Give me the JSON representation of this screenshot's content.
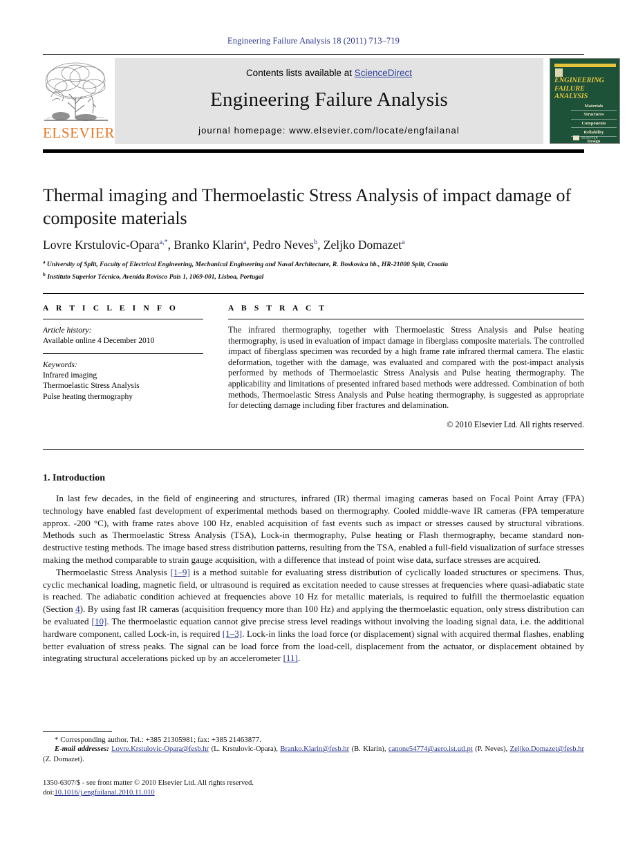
{
  "running_head": "Engineering Failure Analysis 18 (2011) 713–719",
  "masthead": {
    "contents_prefix": "Contents lists available at ",
    "sciencedirect": "ScienceDirect",
    "journal_title": "Engineering Failure Analysis",
    "homepage_label": "journal homepage: www.elsevier.com/locate/engfailanal",
    "publisher": "ELSEVIER",
    "cover": {
      "line1": "ENGINEERING",
      "line2": "FAILURE",
      "line3": "ANALYSIS",
      "topics": [
        "Materials",
        "Structures",
        "Components",
        "Reliability",
        "Design"
      ],
      "foot": "ELSEVIER"
    }
  },
  "article": {
    "title": "Thermal imaging and Thermoelastic Stress Analysis of impact damage of composite materials",
    "authors": [
      {
        "name": "Lovre Krstulovic-Opara",
        "marks": "a,*"
      },
      {
        "name": "Branko Klarin",
        "marks": "a"
      },
      {
        "name": "Pedro Neves",
        "marks": "b"
      },
      {
        "name": "Zeljko Domazet",
        "marks": "a"
      }
    ],
    "affiliations": [
      {
        "mark": "a",
        "text": "University of Split, Faculty of Electrical Engineering, Mechanical Engineering and Naval Architecture, R. Boskovica bb., HR-21000 Split, Croatia"
      },
      {
        "mark": "b",
        "text": "Instituto Superior Técnico, Avenida Rovisco Pais 1, 1069-001, Lisboa, Portugal"
      }
    ]
  },
  "article_info": {
    "heading": "A R T I C L E   I N F O",
    "history_label": "Article history:",
    "history_value": "Available online 4 December 2010",
    "keywords_label": "Keywords:",
    "keywords": [
      "Infrared imaging",
      "Thermoelastic Stress Analysis",
      "Pulse heating thermography"
    ]
  },
  "abstract": {
    "heading": "A B S T R A C T",
    "text": "The infrared thermography, together with Thermoelastic Stress Analysis and Pulse heating thermography, is used in evaluation of impact damage in fiberglass composite materials. The controlled impact of fiberglass specimen was recorded by a high frame rate infrared thermal camera. The elastic deformation, together with the damage, was evaluated and compared with the post-impact analysis performed by methods of Thermoelastic Stress Analysis and Pulse heating thermography. The applicability and limitations of presented infrared based methods were addressed. Combination of both methods, Thermoelastic Stress Analysis and Pulse heating thermography, is suggested as appropriate for detecting damage including fiber fractures and delamination.",
    "copyright": "© 2010 Elsevier Ltd. All rights reserved."
  },
  "introduction": {
    "heading": "1. Introduction",
    "para1_a": "In last few decades, in the field of engineering and structures, infrared (IR) thermal imaging cameras based on Focal Point Array (FPA) technology have enabled fast development of experimental methods based on thermography. Cooled middle-wave IR cameras (FPA temperature approx. -200 °C), with frame rates above 100 Hz, enabled acquisition of fast events such as impact or stresses caused by structural vibrations. Methods such as Thermoelastic Stress Analysis (TSA), Lock-in thermography, Pulse heating or Flash thermography, became standard non-destructive testing methods. The image based stress distribution patterns, resulting from the TSA, enabled a full-field visualization of surface stresses making the method comparable to strain gauge acquisition, with a difference that instead of point wise data, surface stresses are acquired.",
    "para2_a": "Thermoelastic Stress Analysis ",
    "ref_1_9": "[1–9]",
    "para2_b": " is a method suitable for evaluating stress distribution of cyclically loaded structures or specimens. Thus, cyclic mechanical loading, magnetic field, or ultrasound is required as excitation needed to cause stresses at frequencies where quasi-adiabatic state is reached. The adiabatic condition achieved at frequencies above 10 Hz for metallic materials, is required to fulfill the thermoelastic equation (Section ",
    "ref_section4": "4",
    "para2_c": "). By using fast IR cameras (acquisition frequency more than 100 Hz) and applying the thermoelastic equation, only stress distribution can be evaluated ",
    "ref_10": "[10]",
    "para2_d": ". The thermoelastic equation cannot give precise stress level readings without involving the loading signal data, i.e. the additional hardware component, called Lock-in, is required ",
    "ref_1_3": "[1–3]",
    "para2_e": ". Lock-in links the load force (or displacement) signal with acquired thermal flashes, enabling better evaluation of stress peaks. The signal can be load force from the load-cell, displacement from the actuator, or displacement obtained by integrating structural accelerations picked up by an accelerometer ",
    "ref_11": "[11]",
    "para2_f": "."
  },
  "footnotes": {
    "corresponding": "* Corresponding author. Tel.: +385 21305981; fax: +385 21463877.",
    "email_label": "E-mail addresses:",
    "emails": [
      {
        "address": "Lovre.Krstulovic-Opara@fesb.hr",
        "person": "(L. Krstulovic-Opara)"
      },
      {
        "address": "Branko.Klarin@fesb.hr",
        "person": "(B. Klarin)"
      },
      {
        "address": "canone54774@aero.ist.utl.pt",
        "person": "(P. Neves)"
      },
      {
        "address": "Zeljko.Domazet@fesb.hr",
        "person": "(Z. Domazet)"
      }
    ]
  },
  "imprint": {
    "issn_line": "1350-6307/$ - see front matter © 2010 Elsevier Ltd. All rights reserved.",
    "doi_label": "doi:",
    "doi_value": "10.1016/j.engfailanal.2010.11.010"
  },
  "colors": {
    "link_blue": "#26338c",
    "elsevier_orange": "#e87722",
    "cover_green": "#1d5138",
    "cover_gold": "#e5c33b",
    "banner_gray": "#e3e3e3"
  }
}
